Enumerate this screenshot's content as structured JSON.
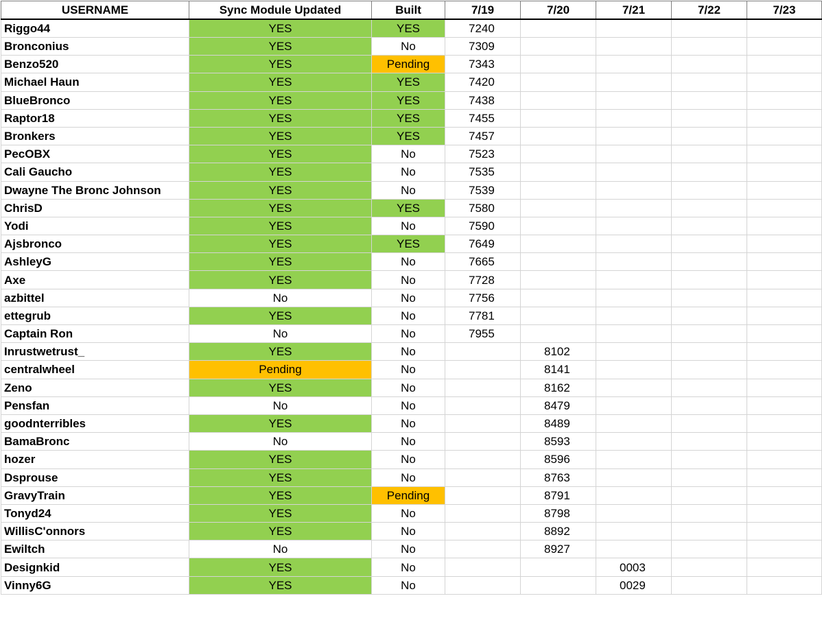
{
  "colors": {
    "yes": "#92d050",
    "pending": "#ffc000",
    "no": "#ffffff"
  },
  "headers": [
    "USERNAME",
    "Sync Module Updated",
    "Built",
    "7/19",
    "7/20",
    "7/21",
    "7/22",
    "7/23"
  ],
  "rows": [
    {
      "user": "Riggo44",
      "sync": "YES",
      "built": "YES",
      "d719": "7240",
      "d720": "",
      "d721": "",
      "d722": "",
      "d723": ""
    },
    {
      "user": "Bronconius",
      "sync": "YES",
      "built": "No",
      "d719": "7309",
      "d720": "",
      "d721": "",
      "d722": "",
      "d723": ""
    },
    {
      "user": "Benzo520",
      "sync": "YES",
      "built": "Pending",
      "d719": "7343",
      "d720": "",
      "d721": "",
      "d722": "",
      "d723": ""
    },
    {
      "user": "Michael Haun",
      "sync": "YES",
      "built": "YES",
      "d719": "7420",
      "d720": "",
      "d721": "",
      "d722": "",
      "d723": ""
    },
    {
      "user": "BlueBronco",
      "sync": "YES",
      "built": "YES",
      "d719": "7438",
      "d720": "",
      "d721": "",
      "d722": "",
      "d723": ""
    },
    {
      "user": "Raptor18",
      "sync": "YES",
      "built": "YES",
      "d719": "7455",
      "d720": "",
      "d721": "",
      "d722": "",
      "d723": ""
    },
    {
      "user": "Bronkers",
      "sync": "YES",
      "built": "YES",
      "d719": "7457",
      "d720": "",
      "d721": "",
      "d722": "",
      "d723": ""
    },
    {
      "user": "PecOBX",
      "sync": "YES",
      "built": "No",
      "d719": "7523",
      "d720": "",
      "d721": "",
      "d722": "",
      "d723": ""
    },
    {
      "user": "Cali Gaucho",
      "sync": "YES",
      "built": "No",
      "d719": "7535",
      "d720": "",
      "d721": "",
      "d722": "",
      "d723": ""
    },
    {
      "user": "Dwayne The Bronc Johnson",
      "sync": "YES",
      "built": "No",
      "d719": "7539",
      "d720": "",
      "d721": "",
      "d722": "",
      "d723": ""
    },
    {
      "user": "ChrisD",
      "sync": "YES",
      "built": "YES",
      "d719": "7580",
      "d720": "",
      "d721": "",
      "d722": "",
      "d723": ""
    },
    {
      "user": "Yodi",
      "sync": "YES",
      "built": "No",
      "d719": "7590",
      "d720": "",
      "d721": "",
      "d722": "",
      "d723": ""
    },
    {
      "user": "Ajsbronco",
      "sync": "YES",
      "built": "YES",
      "d719": "7649",
      "d720": "",
      "d721": "",
      "d722": "",
      "d723": ""
    },
    {
      "user": "AshleyG",
      "sync": "YES",
      "built": "No",
      "d719": "7665",
      "d720": "",
      "d721": "",
      "d722": "",
      "d723": ""
    },
    {
      "user": "Axe",
      "sync": "YES",
      "built": "No",
      "d719": "7728",
      "d720": "",
      "d721": "",
      "d722": "",
      "d723": ""
    },
    {
      "user": "azbittel",
      "sync": "No",
      "built": "No",
      "d719": "7756",
      "d720": "",
      "d721": "",
      "d722": "",
      "d723": ""
    },
    {
      "user": "ettegrub",
      "sync": "YES",
      "built": "No",
      "d719": "7781",
      "d720": "",
      "d721": "",
      "d722": "",
      "d723": ""
    },
    {
      "user": "Captain Ron",
      "sync": "No",
      "built": "No",
      "d719": "7955",
      "d720": "",
      "d721": "",
      "d722": "",
      "d723": ""
    },
    {
      "user": "Inrustwetrust_",
      "sync": "YES",
      "built": "No",
      "d719": "",
      "d720": "8102",
      "d721": "",
      "d722": "",
      "d723": ""
    },
    {
      "user": "centralwheel",
      "sync": "Pending",
      "built": "No",
      "d719": "",
      "d720": "8141",
      "d721": "",
      "d722": "",
      "d723": ""
    },
    {
      "user": "Zeno",
      "sync": "YES",
      "built": "No",
      "d719": "",
      "d720": "8162",
      "d721": "",
      "d722": "",
      "d723": ""
    },
    {
      "user": "Pensfan",
      "sync": "No",
      "built": "No",
      "d719": "",
      "d720": "8479",
      "d721": "",
      "d722": "",
      "d723": ""
    },
    {
      "user": "goodnterribles",
      "sync": "YES",
      "built": "No",
      "d719": "",
      "d720": "8489",
      "d721": "",
      "d722": "",
      "d723": ""
    },
    {
      "user": "BamaBronc",
      "sync": "No",
      "built": "No",
      "d719": "",
      "d720": "8593",
      "d721": "",
      "d722": "",
      "d723": ""
    },
    {
      "user": "hozer",
      "sync": "YES",
      "built": "No",
      "d719": "",
      "d720": "8596",
      "d721": "",
      "d722": "",
      "d723": ""
    },
    {
      "user": "Dsprouse",
      "sync": "YES",
      "built": "No",
      "d719": "",
      "d720": "8763",
      "d721": "",
      "d722": "",
      "d723": ""
    },
    {
      "user": "GravyTrain",
      "sync": "YES",
      "built": "Pending",
      "d719": "",
      "d720": "8791",
      "d721": "",
      "d722": "",
      "d723": ""
    },
    {
      "user": "Tonyd24",
      "sync": "YES",
      "built": "No",
      "d719": "",
      "d720": "8798",
      "d721": "",
      "d722": "",
      "d723": ""
    },
    {
      "user": "WillisC'onnors",
      "sync": "YES",
      "built": "No",
      "d719": "",
      "d720": "8892",
      "d721": "",
      "d722": "",
      "d723": ""
    },
    {
      "user": "Ewiltch",
      "sync": "No",
      "built": "No",
      "d719": "",
      "d720": "8927",
      "d721": "",
      "d722": "",
      "d723": ""
    },
    {
      "user": "Designkid",
      "sync": "YES",
      "built": "No",
      "d719": "",
      "d720": "",
      "d721": "0003",
      "d722": "",
      "d723": ""
    },
    {
      "user": "Vinny6G",
      "sync": "YES",
      "built": "No",
      "d719": "",
      "d720": "",
      "d721": "0029",
      "d722": "",
      "d723": ""
    }
  ]
}
